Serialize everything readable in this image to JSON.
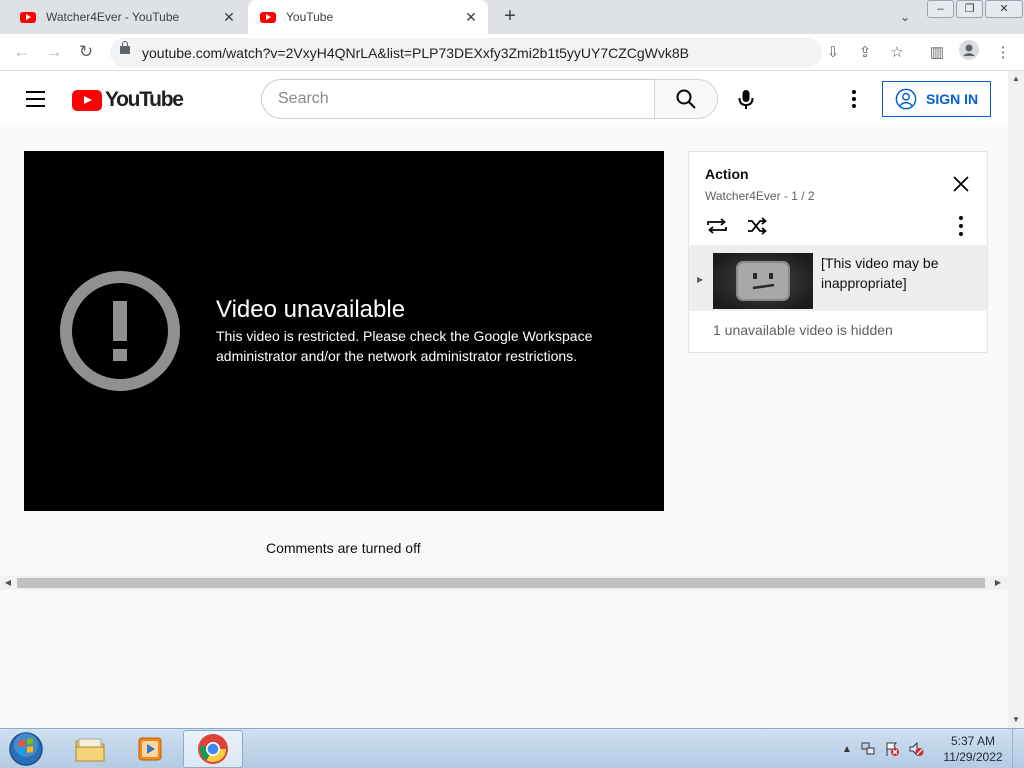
{
  "browser": {
    "tabs": [
      {
        "title": "Watcher4Ever - YouTube",
        "active": false
      },
      {
        "title": "YouTube",
        "active": true
      }
    ],
    "new_tab": "+",
    "url": "youtube.com/watch?v=2VxyH4QNrLA&list=PLP73DEXxfy3Zmi2b1t5yyUY7CZCgWvk8B"
  },
  "youtube": {
    "logo_text": "YouTube",
    "search_placeholder": "Search",
    "sign_in": "SIGN IN"
  },
  "player": {
    "error_title": "Video unavailable",
    "error_message": "This video is restricted. Please check the Google Workspace administrator and/or the network administrator restrictions."
  },
  "comments_status": "Comments are turned off",
  "playlist": {
    "title": "Action",
    "subtitle": "Watcher4Ever - 1 / 2",
    "items": [
      {
        "label": "[This video may be inappropriate]",
        "current": true
      }
    ],
    "hidden_notice": "1 unavailable video is hidden"
  },
  "taskbar": {
    "time": "5:37 AM",
    "date": "11/29/2022",
    "pinned": [
      "windows-explorer",
      "media-player",
      "google-chrome"
    ]
  },
  "colors": {
    "youtube_red": "#ff0000",
    "link_blue": "#065fd4",
    "player_bg": "#000000"
  }
}
